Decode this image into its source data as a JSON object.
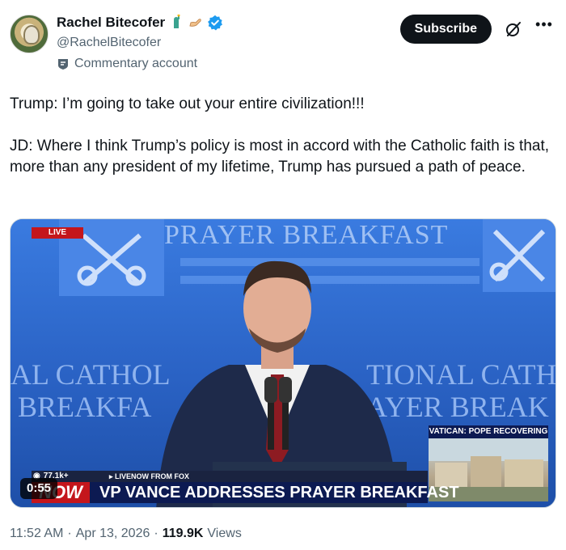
{
  "author": {
    "display_name": "Rachel Bitecofer",
    "emoji_badges": [
      "statue-of-liberty-icon",
      "flexed-arm-icon"
    ],
    "verified": true,
    "handle": "@RachelBitecofer",
    "account_label": "Commentary account",
    "avatar_icon": "skull-rose-avatar"
  },
  "actions": {
    "subscribe_label": "Subscribe",
    "grok_icon": "grok-icon",
    "more_icon": "more-icon"
  },
  "tweet": {
    "paragraph_1": "Trump: I’m going to take out your entire civilization!!!",
    "paragraph_2": "JD: Where I think Trump’s policy is most in accord with the Catholic faith is that, more than any president of my lifetime, Trump has pursued a path of peace."
  },
  "video": {
    "duration": "0:55",
    "overlay": {
      "live_badge": "LIVE",
      "views_mini": "77.1k+",
      "source": "▸ LIVENOW FROM FOX",
      "now_badge": "NOW",
      "headline": "VP VANCE ADDRESSES PRAYER BREAKFAST",
      "inset_label": "VATICAN: POPE RECOVERING"
    },
    "backdrop_text": {
      "top": "PRAYER BREAKFAST",
      "left_line_1": "AL CATHOL",
      "left_line_2": " BREAKFA",
      "right_line_1": "TIONAL CATH",
      "right_line_2": "AYER BREAK"
    }
  },
  "meta": {
    "time": "11:52 AM",
    "separator_1": "·",
    "date": "Apr 13, 2026",
    "separator_2": "·",
    "views_count": "119.9K",
    "views_label": "Views"
  },
  "colors": {
    "text_primary": "#0f1419",
    "text_secondary": "#536471",
    "verified_blue": "#1d9bf0",
    "subscribe_bg": "#0f1419",
    "live_red": "#c4161c",
    "headline_navy": "#0c1a52"
  }
}
